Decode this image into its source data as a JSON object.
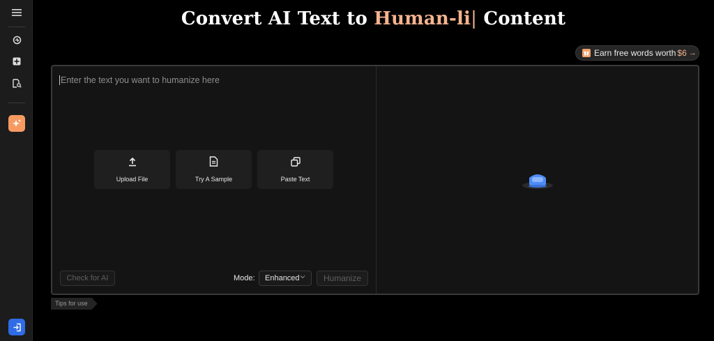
{
  "sidebar": {
    "items": [
      {
        "icon": "menu-icon"
      },
      {
        "icon": "detector-icon"
      },
      {
        "icon": "add-icon"
      },
      {
        "icon": "document-search-icon"
      },
      {
        "icon": "sparkle-icon",
        "active": true
      },
      {
        "icon": "login-icon"
      }
    ]
  },
  "header": {
    "title_prefix": "Convert AI Text to ",
    "title_accent": "Human-li",
    "title_cursor": "|",
    "title_suffix": " Content"
  },
  "promo": {
    "text": "Earn free words worth",
    "amount": "$6",
    "arrow": "→"
  },
  "editor": {
    "placeholder": "Enter the text you want to humanize here",
    "actions": [
      {
        "label": "Upload File",
        "icon": "upload-icon"
      },
      {
        "label": "Try A Sample",
        "icon": "document-icon"
      },
      {
        "label": "Paste Text",
        "icon": "copy-icon"
      }
    ],
    "check_ai_label": "Check for AI",
    "mode_label": "Mode:",
    "mode_value": "Enhanced",
    "humanize_label": "Humanize"
  },
  "tips": {
    "label": "Tips for use"
  },
  "colors": {
    "accent": "#f5b38f",
    "active_sidebar": "#f79a62",
    "login_button": "#2f6ce5",
    "mascot": "#4f8cf5"
  }
}
